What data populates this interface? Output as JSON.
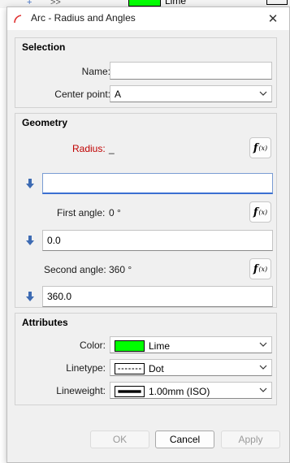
{
  "dialog": {
    "title": "Arc - Radius and Angles",
    "close_glyph": "✕"
  },
  "background": {
    "color_text": "Lime",
    "toolbar_glyphs": [
      "+",
      ">>"
    ]
  },
  "selection": {
    "title": "Selection",
    "name_label": "Name:",
    "name_value": "",
    "center_label": "Center point:",
    "center_value": "A"
  },
  "geometry": {
    "title": "Geometry",
    "radius_label": "Radius:",
    "radius_value": "_",
    "radius_input": "",
    "first_label": "First angle:",
    "first_value": "0 °",
    "first_input": "0.0",
    "second_label": "Second angle:",
    "second_value": "360 °",
    "second_input": "360.0",
    "fx_glyph": "f",
    "fx_sub": "(x)"
  },
  "attributes": {
    "title": "Attributes",
    "color_label": "Color:",
    "color_value": "Lime",
    "color_hex": "#00ff00",
    "linetype_label": "Linetype:",
    "linetype_value": "Dot",
    "lineweight_label": "Lineweight:",
    "lineweight_value": "1.00mm (ISO)"
  },
  "buttons": {
    "ok": "OK",
    "cancel": "Cancel",
    "apply": "Apply"
  },
  "colors": {
    "accent": "#3b6fd1",
    "radius_label": "#c00000",
    "arrow_blue": "#3d6bb3"
  }
}
